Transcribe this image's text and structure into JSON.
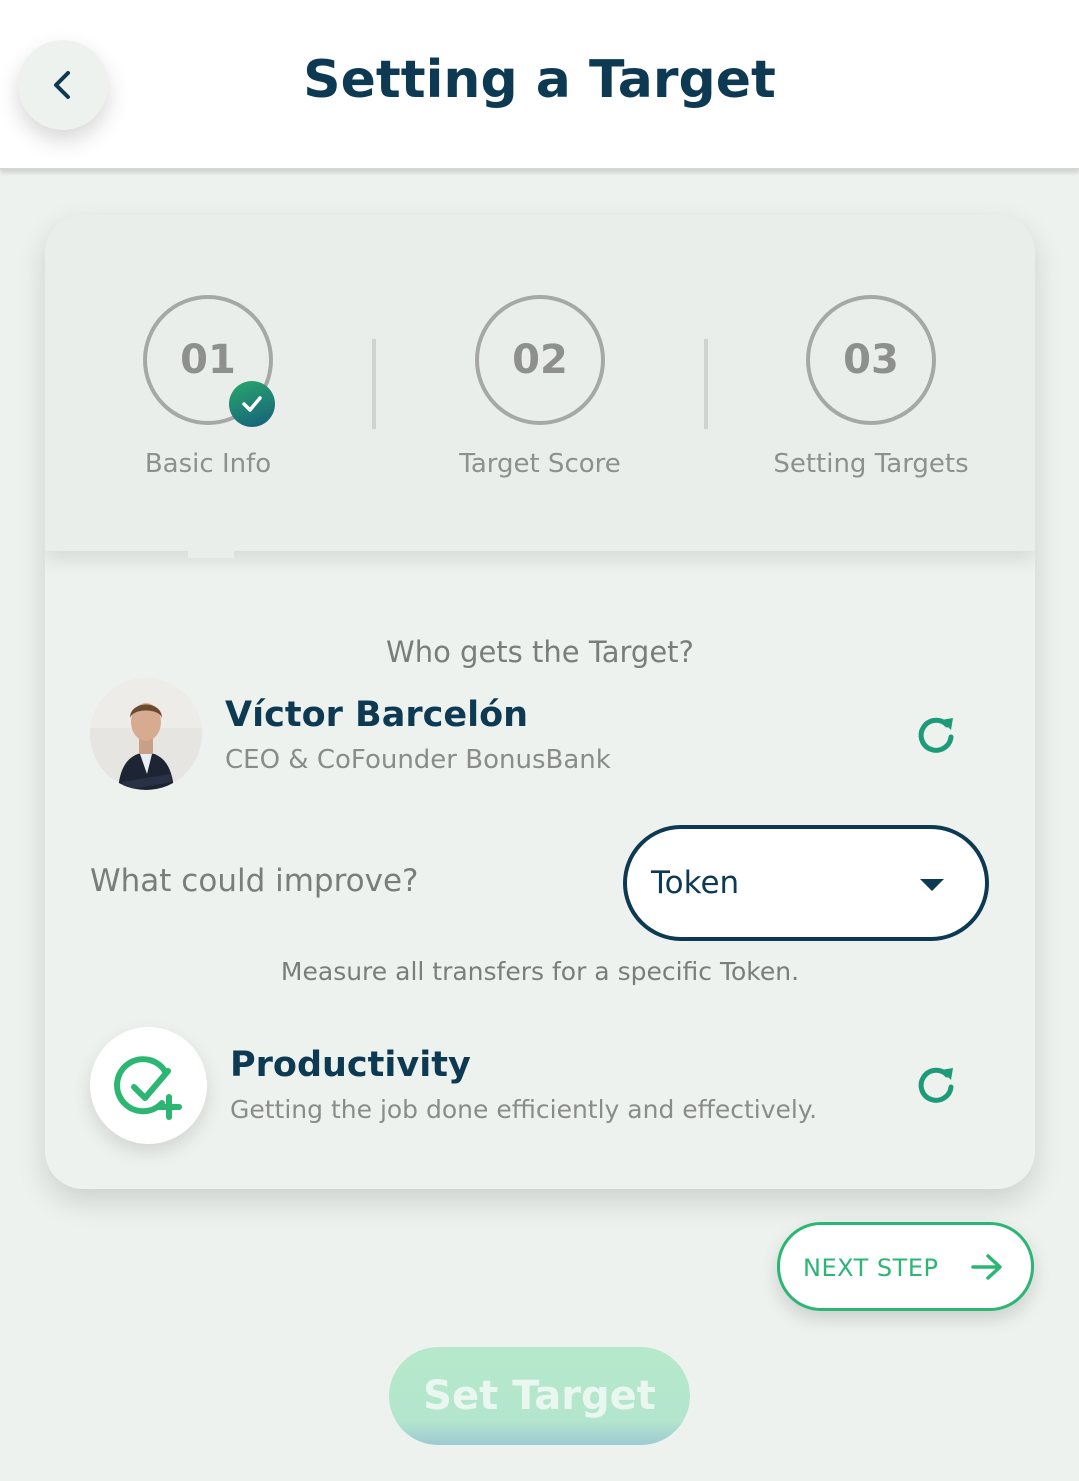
{
  "header": {
    "title": "Setting a Target",
    "back_icon": "chevron-left-icon"
  },
  "steps": [
    {
      "number": "01",
      "label": "Basic Info",
      "completed": true
    },
    {
      "number": "02",
      "label": "Target Score",
      "completed": false
    },
    {
      "number": "03",
      "label": "Setting Targets",
      "completed": false
    }
  ],
  "form": {
    "who_title": "Who gets the Target?",
    "person": {
      "name": "Víctor Barcelón",
      "role": "CEO & CoFounder BonusBank"
    },
    "improve_label": "What could improve?",
    "improve_select": {
      "value": "Token"
    },
    "measure_text": "Measure all transfers for a specific Token.",
    "productivity": {
      "title": "Productivity",
      "description": "Getting the job done efficiently and effectively."
    }
  },
  "actions": {
    "next_step": "NEXT STEP",
    "set_target": "Set Target"
  },
  "colors": {
    "navy": "#0d3a52",
    "green": "#2bb673",
    "background": "#eef2ef"
  }
}
